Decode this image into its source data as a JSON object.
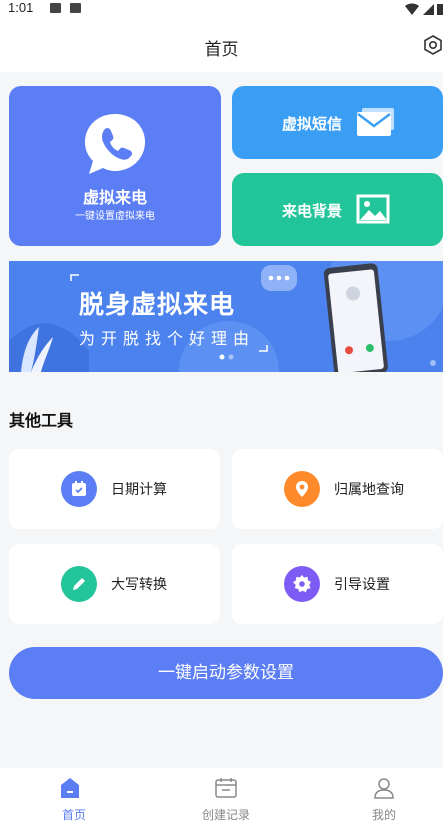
{
  "status_bar": {
    "time": "1:01"
  },
  "header": {
    "title": "首页"
  },
  "features": {
    "call": {
      "title": "虚拟来电",
      "subtitle": "一键设置虚拟来电"
    },
    "sms": {
      "title": "虚拟短信"
    },
    "background": {
      "title": "来电背景"
    }
  },
  "banner": {
    "title": "脱身虚拟来电",
    "subtitle": "为开脱找个好理由",
    "slide_count": 2,
    "active_slide": 1
  },
  "tools": {
    "section_title": "其他工具",
    "items": [
      {
        "label": "日期计算",
        "icon": "calendar-icon",
        "color": "#5b7ef5"
      },
      {
        "label": "归属地查询",
        "icon": "location-pin-icon",
        "color": "#ff8a2b"
      },
      {
        "label": "大写转换",
        "icon": "pencil-icon",
        "color": "#22c59a"
      },
      {
        "label": "引导设置",
        "icon": "gear-icon",
        "color": "#7c5cf5"
      }
    ]
  },
  "cta": {
    "label": "一键启动参数设置"
  },
  "tabbar": {
    "items": [
      {
        "label": "首页",
        "icon": "home-icon",
        "active": true
      },
      {
        "label": "创建记录",
        "icon": "records-icon",
        "active": false
      },
      {
        "label": "我的",
        "icon": "profile-icon",
        "active": false
      }
    ]
  },
  "colors": {
    "accent": "#5b7ef5",
    "sms": "#3a9ef5",
    "background_card": "#22c59a"
  }
}
